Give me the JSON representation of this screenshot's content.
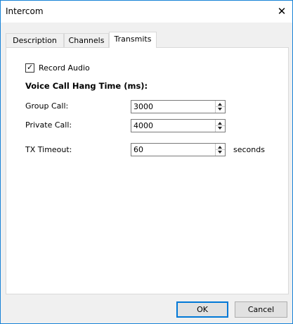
{
  "window": {
    "title": "Intercom",
    "close_glyph": "✕"
  },
  "tabs": [
    {
      "label": "Description"
    },
    {
      "label": "Channels"
    },
    {
      "label": "Transmits"
    }
  ],
  "transmits": {
    "record_audio": {
      "label": "Record Audio",
      "checked": true
    },
    "heading": "Voice Call Hang Time (ms):",
    "group_call": {
      "label": "Group Call:",
      "value": "3000"
    },
    "private_call": {
      "label": "Private Call:",
      "value": "4000"
    },
    "tx_timeout": {
      "label": "TX Timeout:",
      "value": "60",
      "unit": "seconds"
    }
  },
  "buttons": {
    "ok": "OK",
    "cancel": "Cancel"
  },
  "colors": {
    "accent": "#0078d7",
    "border": "#1883d7"
  }
}
